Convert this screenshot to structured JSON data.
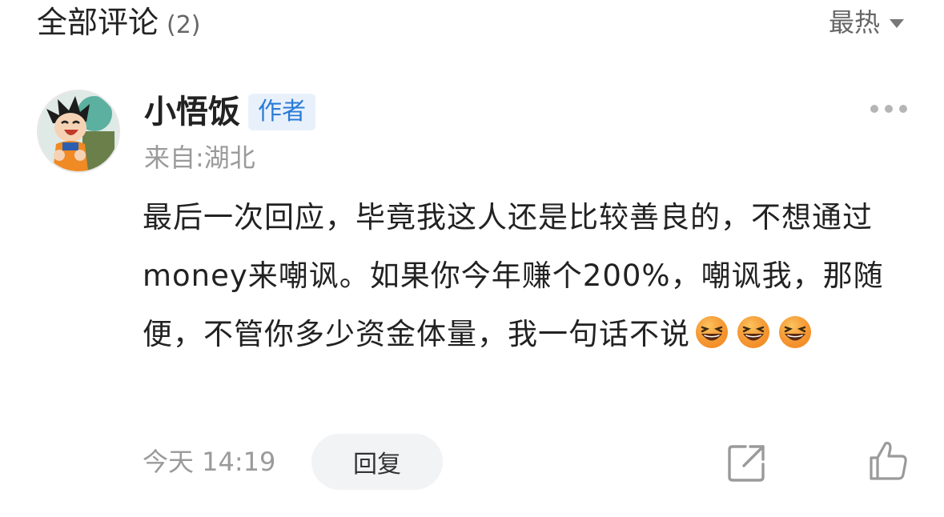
{
  "header": {
    "title": "全部评论",
    "count": "(2)",
    "sort_label": "最热"
  },
  "comment": {
    "author": "小悟饭",
    "badge": "作者",
    "location": "来自:湖北",
    "text": "最后一次回应，毕竟我这人还是比较善良的，不想通过money来嘲讽。如果你今年赚个200%，嘲讽我，那随便，不管你多少资金体量，我一句话不说",
    "emojis": [
      "laughing-emoji",
      "laughing-emoji",
      "laughing-emoji"
    ],
    "time": "今天 14:19",
    "reply_label": "回复"
  },
  "icons": {
    "more": "more-dots-icon",
    "share": "share-icon",
    "like": "thumbs-up-icon",
    "sort": "caret-down-icon"
  },
  "colors": {
    "badge_text": "#2a7bd8",
    "badge_bg": "#e8f1fb",
    "muted_text": "#9a9a9a",
    "reply_bg": "#f2f3f5"
  }
}
